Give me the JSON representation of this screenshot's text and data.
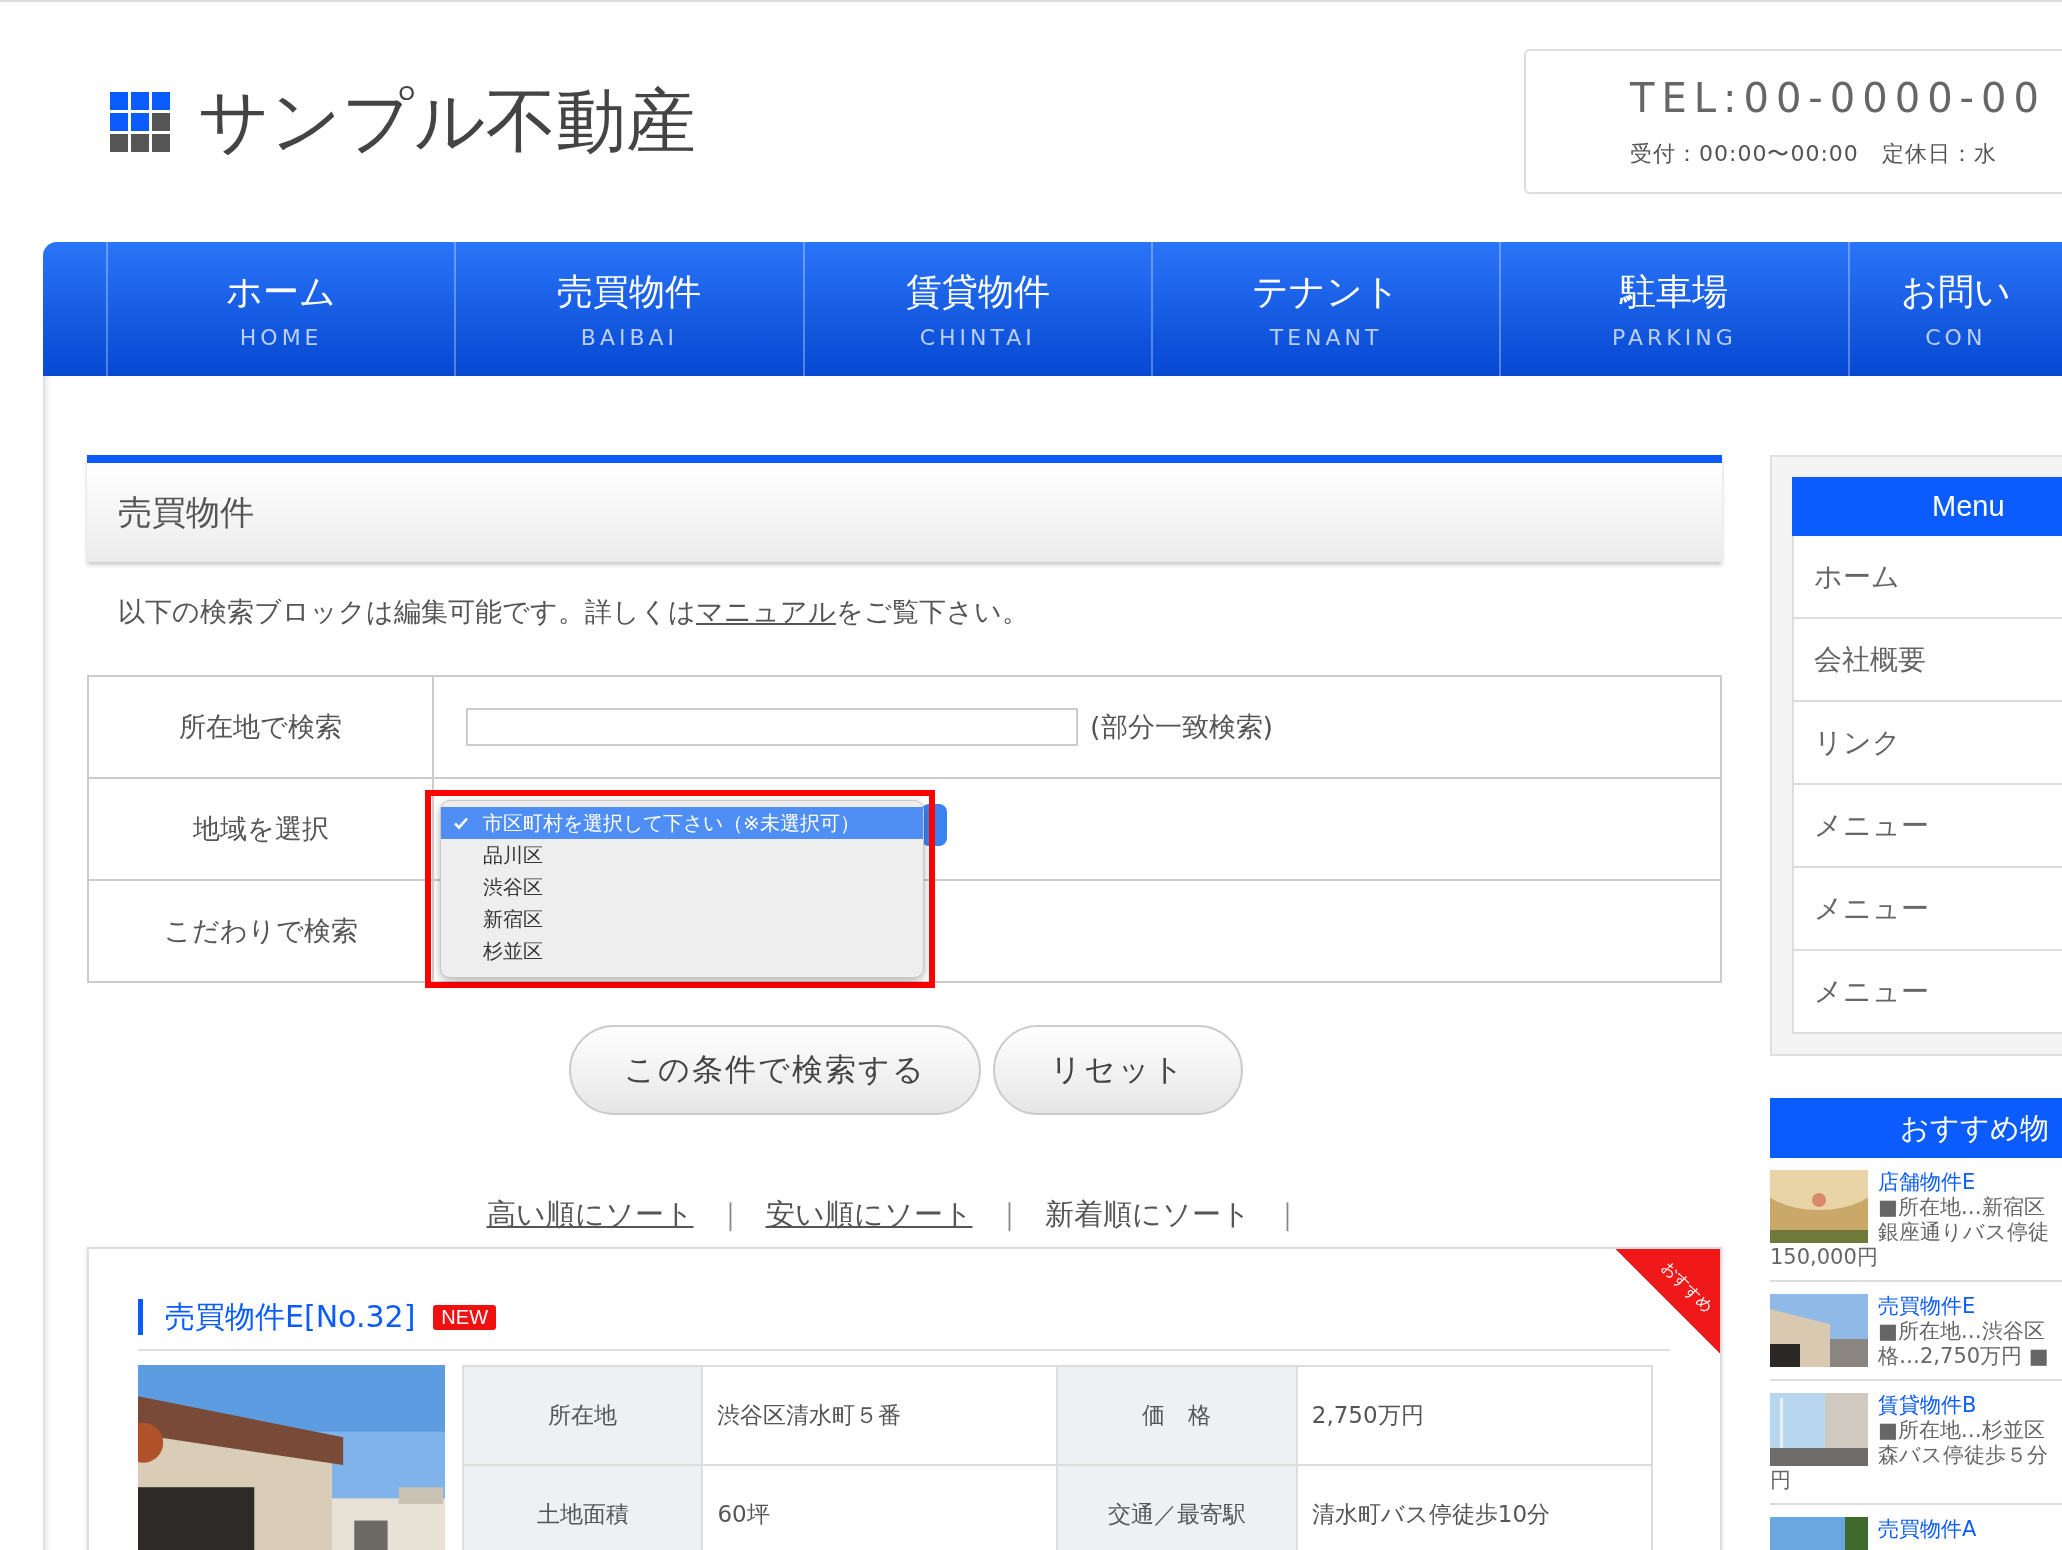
{
  "header": {
    "site_title": "サンプル不動産",
    "tel": "TEL:00-0000-00",
    "hours": "受付：00:00〜00:00　定休日：水"
  },
  "nav": [
    {
      "label": "ホーム",
      "sub": "HOME"
    },
    {
      "label": "売買物件",
      "sub": "BAIBAI"
    },
    {
      "label": "賃貸物件",
      "sub": "CHINTAI"
    },
    {
      "label": "テナント",
      "sub": "TENANT"
    },
    {
      "label": "駐車場",
      "sub": "PARKING"
    },
    {
      "label": "お問い",
      "sub": "CON"
    }
  ],
  "page_heading": "売買物件",
  "intro": {
    "before": "以下の検索ブロックは編集可能です。詳しくは",
    "link": "マニュアル",
    "after": "をご覧下さい。"
  },
  "search": {
    "rows": [
      {
        "kind": "text",
        "label": "所在地で検索",
        "note": "(部分一致検索)"
      },
      {
        "kind": "select",
        "label": "地域を選択"
      },
      {
        "kind": "empty",
        "label": "こだわりで検索"
      }
    ],
    "dropdown": {
      "highlighted": true,
      "options": [
        {
          "label": "市区町村を選択して下さい（※未選択可）",
          "selected": true
        },
        {
          "label": "品川区",
          "selected": false
        },
        {
          "label": "渋谷区",
          "selected": false
        },
        {
          "label": "新宿区",
          "selected": false
        },
        {
          "label": "杉並区",
          "selected": false
        }
      ]
    },
    "buttons": [
      "この条件で検索する",
      "リセット"
    ]
  },
  "sort": {
    "separator": "｜",
    "items": [
      {
        "label": "高い順にソート",
        "link": true
      },
      {
        "label": "安い順にソート",
        "link": true
      },
      {
        "label": "新着順にソート",
        "link": false
      }
    ]
  },
  "listing": {
    "title": "売買物件E[No.32]",
    "badge": "NEW",
    "ribbon": "おすすめ",
    "rows": [
      [
        "所在地",
        "渋谷区清水町５番",
        "価　格",
        "2,750万円"
      ],
      [
        "土地面積",
        "60坪",
        "交通／最寄駅",
        "清水町バス停徒歩10分"
      ]
    ]
  },
  "sidebar": {
    "menu_title": "Menu",
    "menu": [
      "ホーム",
      "会社概要",
      "リンク",
      "メニュー",
      "メニュー",
      "メニュー"
    ],
    "featured_title": "おすすめ物",
    "featured": [
      {
        "title": "店舗物件E",
        "lines": [
          "■所在地…新宿区",
          "銀座通りバス停徒"
        ],
        "tail": "150,000円"
      },
      {
        "title": "売買物件E",
        "lines": [
          "■所在地…渋谷区",
          "格…2,750万円 ■"
        ]
      },
      {
        "title": "賃貸物件B",
        "lines": [
          "■所在地…杉並区",
          "森バス停徒歩５分"
        ],
        "tail": "円"
      },
      {
        "title": "売買物件A"
      }
    ]
  }
}
